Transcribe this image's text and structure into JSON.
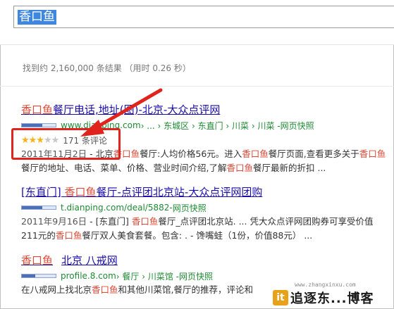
{
  "search": {
    "query": "香口鱼"
  },
  "stats": "找到约 2,160,000 条结果  （用时 0.26 秒）",
  "results": [
    {
      "title_hl": "香口鱼",
      "title_rest": "餐厅电话,地址(图)-北京-大众点评网",
      "url": "www.dianping.com",
      "breadcrumb": " › ... › 东城区 › 东直门 › 川菜 › 川菜 - ",
      "snapshot": "网页快照",
      "rating_count": "171 条评论",
      "date": "2011年11月2日",
      "snippet_parts": [
        " - 北京",
        "香口鱼",
        "餐厅:人均价格56元。进入",
        "香口鱼",
        "餐厅页面,查看更多关于",
        "香口鱼",
        "餐厅的地址、电话、菜单、价格、营业时间介绍,了解",
        "香口鱼",
        "餐厅最新的折扣 ..."
      ]
    },
    {
      "title_pre": "[东直门] ",
      "title_hl": "香口鱼",
      "title_rest": "餐厅-点评团北京站-大众点评网团购",
      "url": "t.dianping.com/deal/5882",
      "breadcrumb": " - ",
      "snapshot": "网页快照",
      "date": "2011年9月16日",
      "snippet_parts": [
        " - [东直门] ",
        "香口鱼",
        "餐厅_点评团北京站. ... 凭大众点评网团购券可享受价值211元的",
        "香口鱼",
        "餐厅双人美食套餐。包含: . - 馋嘴蛙（1份，价值88元） ..."
      ]
    },
    {
      "title_hl": "香口鱼",
      "title_rest": "北京  八戒网",
      "url": "profile.8.com",
      "breadcrumb": " › 餐厅 › 川菜馆 - ",
      "snapshot": "网页快照",
      "snippet_parts": [
        "在八戒网上找北京",
        "香口鱼",
        "和其他川菜馆,餐厅的推荐，评论和"
      ]
    }
  ],
  "watermark": {
    "url": "www.zhangxinxu.com",
    "logo_mark": "it",
    "logo_text": "追逐东...博客"
  },
  "colors": {
    "link": "#1a0dab",
    "highlight": "#dd4b39",
    "url_green": "#1f8a34",
    "callout_red": "#e0231c",
    "query_bg": "#3d87e0"
  },
  "rating": {
    "stars_on": 3,
    "stars_total": 5
  }
}
